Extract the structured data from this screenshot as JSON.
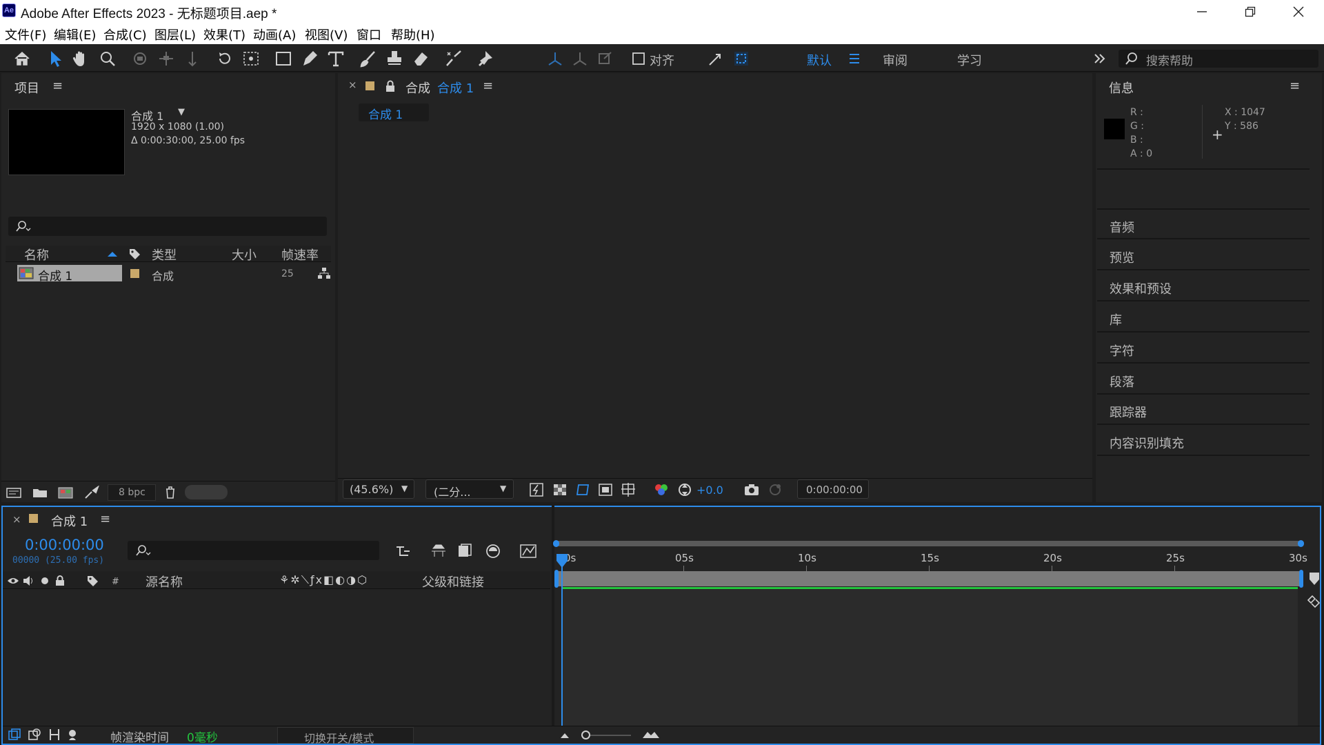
{
  "window": {
    "app_logo": "Ae",
    "title": "Adobe After Effects 2023 - 无标题项目.aep *"
  },
  "menu": [
    "文件(F)",
    "编辑(E)",
    "合成(C)",
    "图层(L)",
    "效果(T)",
    "动画(A)",
    "视图(V)",
    "窗口",
    "帮助(H)"
  ],
  "toolbar": {
    "align_label": "对齐",
    "workspaces": [
      "默认",
      "审阅",
      "学习"
    ],
    "active_workspace": "默认",
    "help_placeholder": "搜索帮助"
  },
  "project_panel": {
    "tab": "项目",
    "comp_name": "合成 1",
    "comp_dims": "1920 x 1080 (1.00)",
    "comp_duration": "Δ 0:00:30:00, 25.00 fps",
    "columns": [
      "名称",
      "类型",
      "大小",
      "帧速率"
    ],
    "items": [
      {
        "name": "合成 1",
        "type": "合成",
        "size": "",
        "fps": "25"
      }
    ],
    "bpc": "8 bpc"
  },
  "composition_panel": {
    "tab_prefix": "合成",
    "tab_name": "合成 1",
    "flow_tab": "合成 1",
    "zoom": "(45.6%)",
    "resolution": "(二分...",
    "exposure": "+0.0",
    "timecode": "0:00:00:00"
  },
  "info_panel": {
    "tab": "信息",
    "r_label": "R :",
    "g_label": "G :",
    "b_label": "B :",
    "a_label": "A : 0",
    "x_label": "X : 1047",
    "y_label": "Y : 586",
    "swatch_color": "#000000",
    "items": [
      "音频",
      "预览",
      "效果和预设",
      "库",
      "字符",
      "段落",
      "跟踪器",
      "内容识别填充"
    ]
  },
  "timeline": {
    "tab": "合成 1",
    "timecode": "0:00:00:00",
    "frame_info": "00000 (25.00 fps)",
    "col_number": "#",
    "col_source": "源名称",
    "col_parent": "父级和链接",
    "ruler_labels": [
      "0s",
      "05s",
      "10s",
      "15s",
      "20s",
      "25s",
      "30s"
    ],
    "render_time_label": "帧渲染时间",
    "render_time_value": "0毫秒",
    "toggle_modes": "切换开关/模式"
  },
  "colors": {
    "accent": "#2d8ceb",
    "work_area": "#23c43e",
    "panel_bg": "#232323",
    "app_bg": "#1d1d1d"
  }
}
